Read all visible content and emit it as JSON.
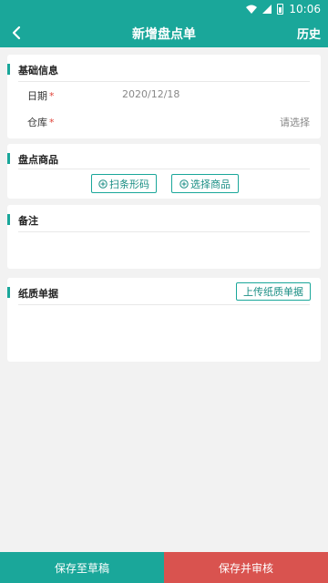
{
  "status": {
    "time": "10:06"
  },
  "header": {
    "back_icon": "chevron-left-icon",
    "title": "新增盘点单",
    "history": "历史"
  },
  "basic": {
    "title": "基础信息",
    "date_label": "日期",
    "date_value": "2020/12/18",
    "warehouse_label": "仓库",
    "warehouse_placeholder": "请选择",
    "required_mark": "*"
  },
  "products": {
    "title": "盘点商品",
    "scan_label": "扫条形码",
    "select_label": "选择商品"
  },
  "remarks": {
    "title": "备注"
  },
  "paper": {
    "title": "纸质单据",
    "upload_label": "上传纸质单据"
  },
  "footer": {
    "draft_label": "保存至草稿",
    "submit_label": "保存并审核"
  },
  "colors": {
    "primary": "#1aa79a",
    "danger": "#d9534f",
    "required": "#e0443a"
  }
}
